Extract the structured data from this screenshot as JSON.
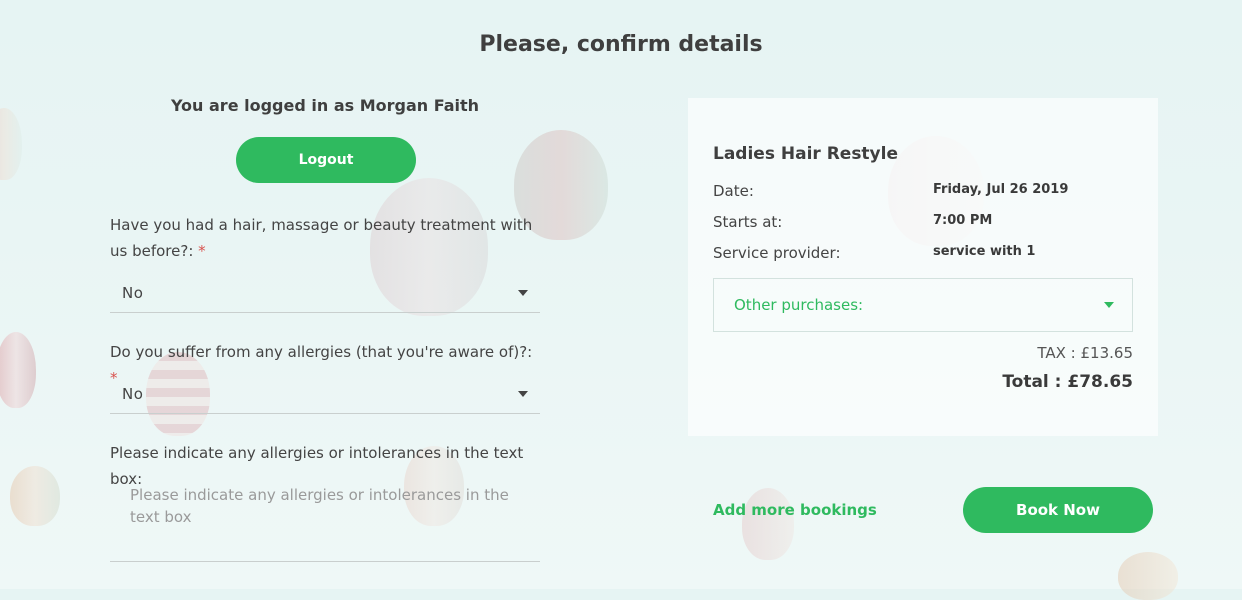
{
  "page": {
    "title": "Please, confirm details"
  },
  "account": {
    "logged_in_text": "You are logged in as Morgan Faith",
    "logout_label": "Logout"
  },
  "form": {
    "q1": {
      "label": "Have you had a hair, massage or beauty treatment with us before?:",
      "required_mark": "*",
      "value": "No"
    },
    "q2": {
      "label": "Do you suffer from any allergies (that you're aware of)?:",
      "required_mark": "*",
      "value": "No"
    },
    "q3": {
      "label": "Please indicate any allergies or intolerances in the text box:",
      "placeholder": "Please indicate any allergies or intolerances in the text box"
    }
  },
  "summary": {
    "service_name": "Ladies Hair Restyle",
    "rows": [
      {
        "label": "Date:",
        "value": "Friday, Jul 26 2019"
      },
      {
        "label": "Starts at:",
        "value": "7:00 PM"
      },
      {
        "label": "Service provider:",
        "value": "service with 1"
      }
    ],
    "other_purchases_label": "Other purchases:",
    "tax": "TAX : £13.65",
    "total": "Total : £78.65"
  },
  "actions": {
    "add_more_label": "Add more bookings",
    "book_now_label": "Book Now"
  },
  "colors": {
    "accent": "#2fba5f",
    "required": "#d9534f",
    "background": "#e6f4f3"
  },
  "icons": {
    "dropdown": "caret-down-icon"
  }
}
